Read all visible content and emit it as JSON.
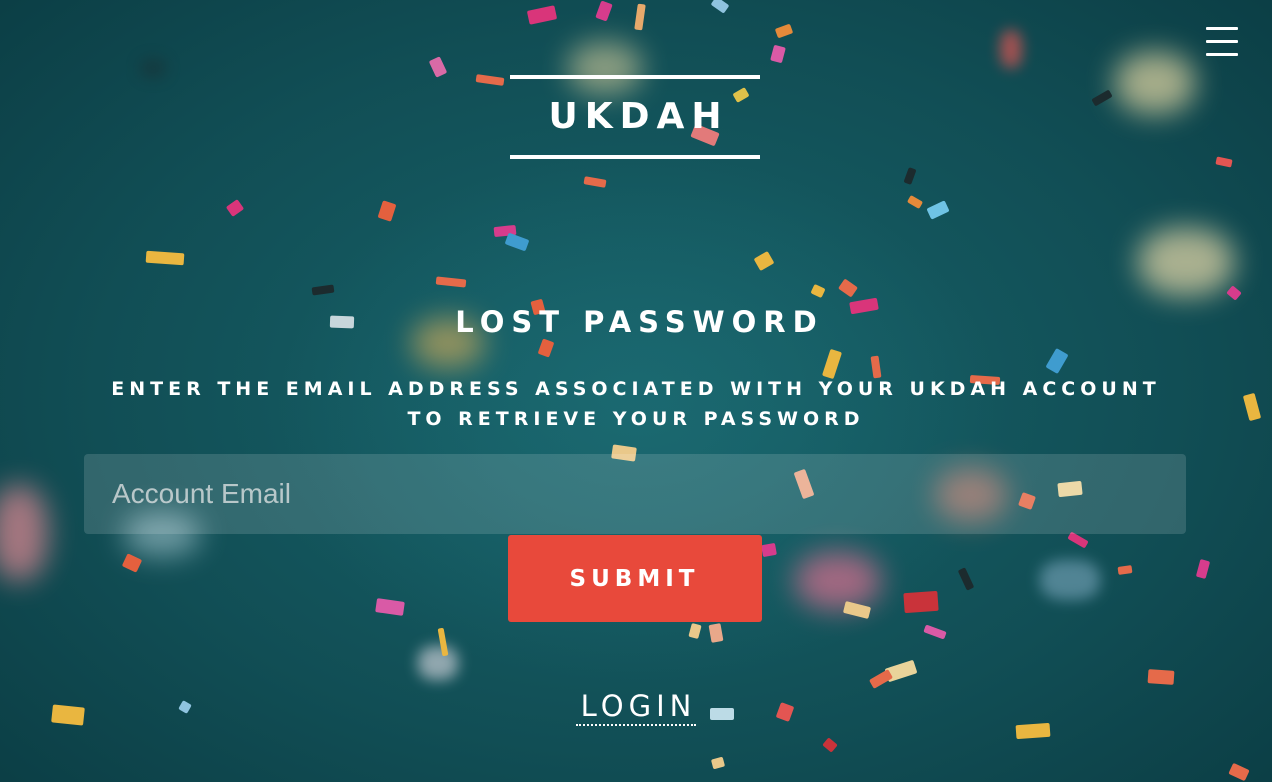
{
  "colors": {
    "background": "#14565c",
    "accent": "#e8493b",
    "text": "#ffffff"
  },
  "menu": {
    "icon": "hamburger-menu-icon"
  },
  "brand": {
    "logo_text": "UKDAH"
  },
  "form": {
    "title": "LOST PASSWORD",
    "instructions": "ENTER THE EMAIL ADDRESS ASSOCIATED WITH YOUR UKDAH ACCOUNT TO RETRIEVE YOUR PASSWORD",
    "email_value": "",
    "email_placeholder": "Account Email",
    "submit_label": "SUBMIT"
  },
  "footer": {
    "login_label": "LOGIN"
  }
}
